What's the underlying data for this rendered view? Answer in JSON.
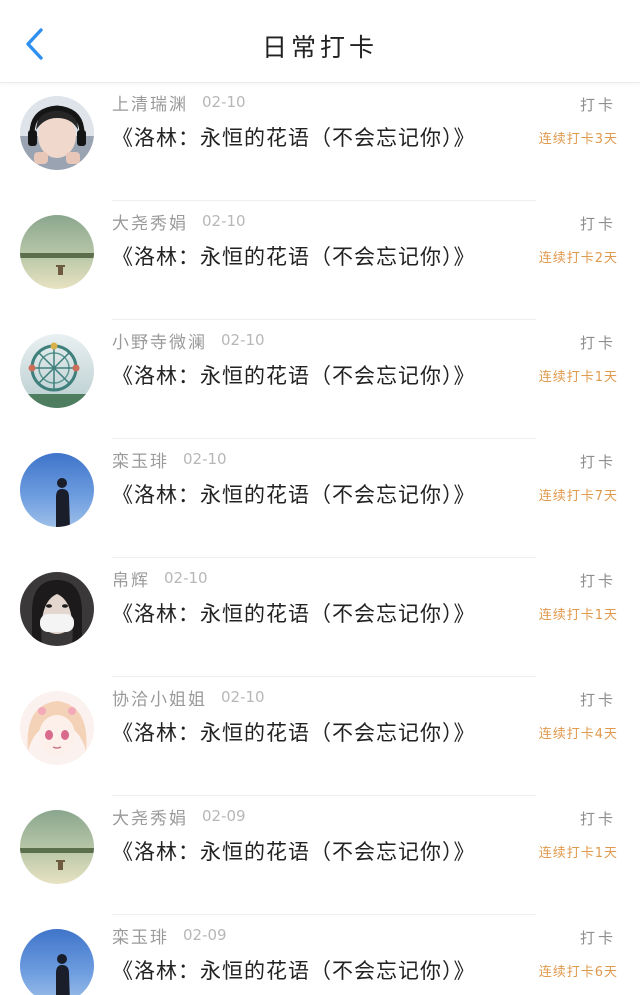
{
  "header": {
    "title": "日常打卡",
    "back_icon": "chevron-left-icon",
    "accent_color": "#2f8ff0"
  },
  "checkin_label": "打卡",
  "streak_color": "#e09a4e",
  "items": [
    {
      "user": "上清瑞渊",
      "date": "02-10",
      "book": "《洛林：永恒的花语（不会忘记你）》",
      "streak": "连续打卡3天",
      "avatar": "boy-with-headphones"
    },
    {
      "user": "大尧秀娟",
      "date": "02-10",
      "book": "《洛林：永恒的花语（不会忘记你）》",
      "streak": "连续打卡2天",
      "avatar": "field-landscape-with-chair"
    },
    {
      "user": "小野寺微澜",
      "date": "02-10",
      "book": "《洛林：永恒的花语（不会忘记你）》",
      "streak": "连续打卡1天",
      "avatar": "ferris-wheel"
    },
    {
      "user": "栾玉琲",
      "date": "02-10",
      "book": "《洛林：永恒的花语（不会忘记你）》",
      "streak": "连续打卡7天",
      "avatar": "silhouette-blue-sky"
    },
    {
      "user": "帛辉",
      "date": "02-10",
      "book": "《洛林：永恒的花语（不会忘记你）》",
      "streak": "连续打卡1天",
      "avatar": "girl-with-mask"
    },
    {
      "user": "协洽小姐姐",
      "date": "02-10",
      "book": "《洛林：永恒的花语（不会忘记你）》",
      "streak": "连续打卡4天",
      "avatar": "anime-girl"
    },
    {
      "user": "大尧秀娟",
      "date": "02-09",
      "book": "《洛林：永恒的花语（不会忘记你）》",
      "streak": "连续打卡1天",
      "avatar": "field-landscape-with-chair"
    },
    {
      "user": "栾玉琲",
      "date": "02-09",
      "book": "《洛林：永恒的花语（不会忘记你）》",
      "streak": "连续打卡6天",
      "avatar": "silhouette-blue-sky"
    }
  ]
}
